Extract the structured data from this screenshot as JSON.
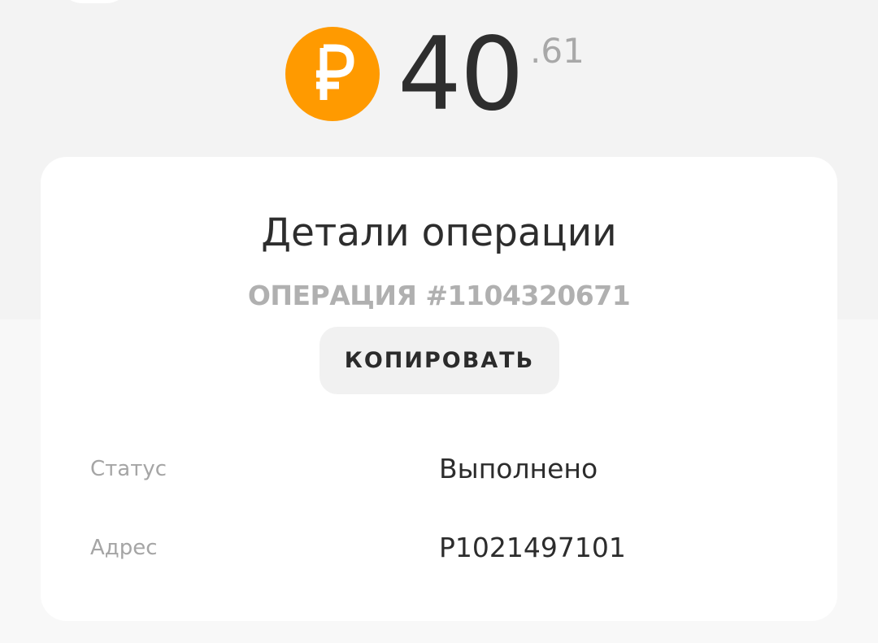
{
  "balance": {
    "currency_icon": "ruble-coin-icon",
    "currency_color": "#ff9a00",
    "amount_integer": "40",
    "amount_fraction": ".61"
  },
  "details": {
    "title": "Детали операции",
    "operation_number": "ОПЕРАЦИЯ #1104320671",
    "copy_label": "КОПИРОВАТЬ",
    "rows": [
      {
        "label": "Статус",
        "value": "Выполнено"
      },
      {
        "label": "Адрес",
        "value": "P1021497101"
      }
    ]
  }
}
